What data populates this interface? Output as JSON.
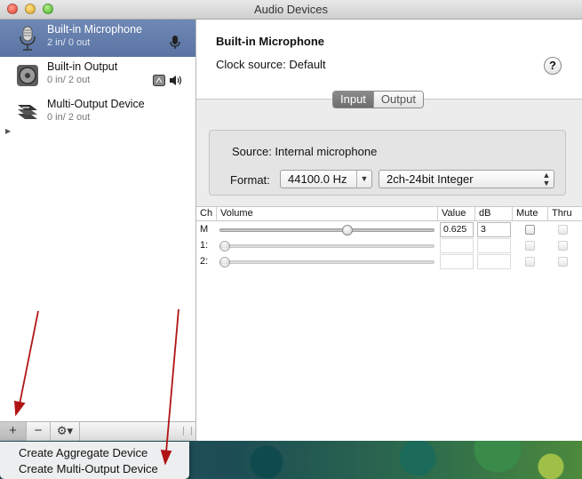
{
  "window": {
    "title": "Audio Devices"
  },
  "devices": [
    {
      "name": "Built-in Microphone",
      "io": "2 in/ 0 out",
      "icon": "microphone-icon",
      "selected": true
    },
    {
      "name": "Built-in Output",
      "io": "0 in/ 2 out",
      "icon": "speaker-icon",
      "selected": false
    },
    {
      "name": "Multi-Output Device",
      "io": "0 in/ 2 out",
      "icon": "multi-output-icon",
      "selected": false
    }
  ],
  "toolbar": {
    "add_label": "+",
    "remove_label": "−",
    "gear_label": "⚙▾"
  },
  "detail": {
    "device_name": "Built-in Microphone",
    "clock_source": "Clock source:  Default",
    "help_label": "?",
    "tabs": [
      "Input",
      "Output"
    ],
    "source": "Source:  Internal microphone",
    "format_label": "Format:",
    "format_rate": "44100.0 Hz",
    "format_bits": "2ch-24bit Integer"
  },
  "table": {
    "headers": [
      "Ch",
      "Volume",
      "Value",
      "dB",
      "Mute",
      "Thru"
    ],
    "rows": [
      {
        "ch": "M",
        "value": "0.625",
        "db": "3",
        "level": 0.6
      },
      {
        "ch": "1:",
        "value": "",
        "db": "",
        "level": 0
      },
      {
        "ch": "2:",
        "value": "",
        "db": "",
        "level": 0
      }
    ]
  },
  "popup_menu": [
    "Create Aggregate Device",
    "Create Multi-Output Device"
  ],
  "colors": {
    "selection": "#6a82b0",
    "annotation_arrow": "#b01414"
  }
}
